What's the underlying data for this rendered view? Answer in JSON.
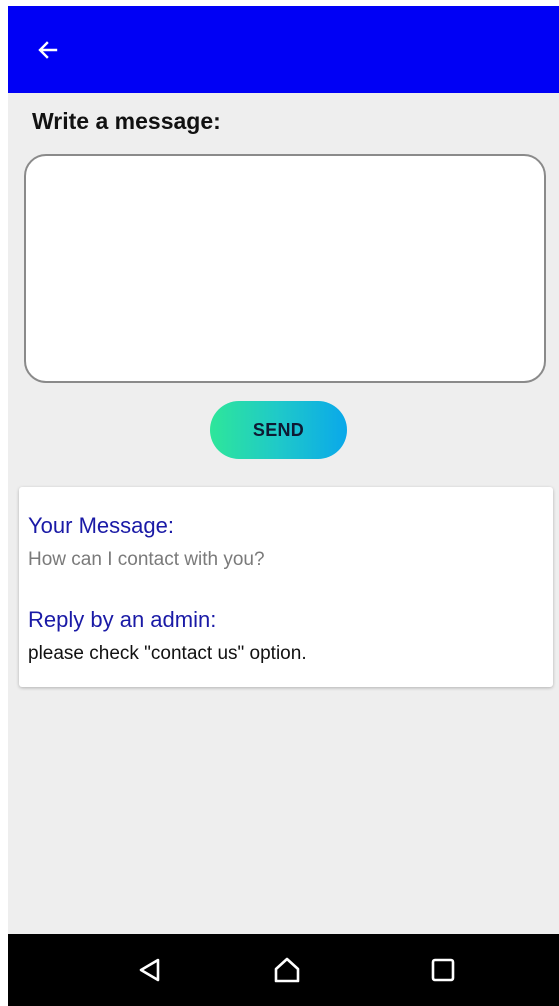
{
  "app_bar": {
    "back_icon": "arrow-left-icon",
    "background_color": "#0000f5"
  },
  "compose": {
    "label": "Write a message:",
    "input_value": "",
    "input_placeholder": "",
    "send_label": "SEND"
  },
  "message_card": {
    "your_message_heading": "Your Message:",
    "your_message_text": "How can I contact with you?",
    "reply_heading": "Reply by an admin:",
    "reply_text": "please check \"contact us\" option."
  },
  "nav_bar": {
    "back_icon": "triangle-back-icon",
    "home_icon": "home-icon",
    "recents_icon": "square-recents-icon"
  }
}
